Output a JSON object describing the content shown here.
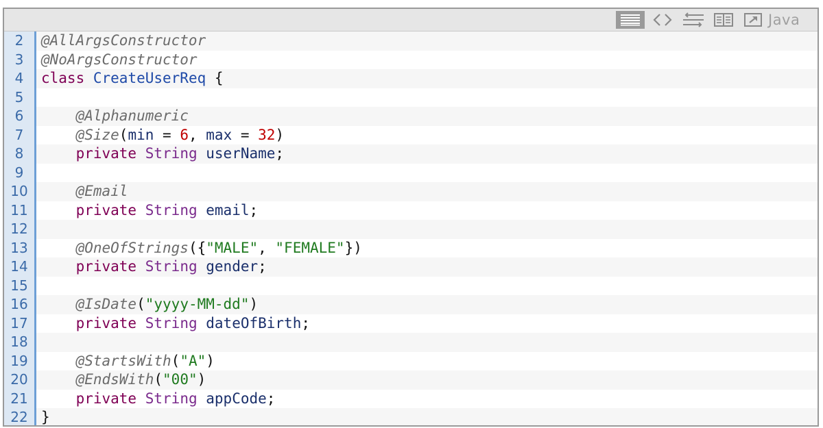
{
  "toolbar": {
    "icons": [
      {
        "name": "view-source-icon"
      },
      {
        "name": "code-brackets-icon"
      },
      {
        "name": "wrap-lines-icon"
      },
      {
        "name": "copy-icon"
      },
      {
        "name": "popout-icon"
      }
    ],
    "language": "Java"
  },
  "colors": {
    "annotation": "#6b6b6b",
    "keyword": "#7f0055",
    "type": "#7a2a8c",
    "class_name": "#1f4aa8",
    "identifier": "#1a2f6b",
    "string": "#1f7a1f",
    "number": "#c00000",
    "gutter_bg": "#dde8f4",
    "gutter_border": "#6d9fd6",
    "gutter_text": "#3a6aa8"
  },
  "code": {
    "lines": [
      {
        "n": "2",
        "t": [
          [
            "ann",
            "@AllArgsConstructor"
          ]
        ]
      },
      {
        "n": "3",
        "t": [
          [
            "ann",
            "@NoArgsConstructor"
          ]
        ]
      },
      {
        "n": "4",
        "t": [
          [
            "kw",
            "class"
          ],
          [
            "pun",
            " "
          ],
          [
            "cls",
            "CreateUserReq"
          ],
          [
            "pun",
            " {"
          ]
        ]
      },
      {
        "n": "5",
        "t": []
      },
      {
        "n": "6",
        "t": [
          [
            "pun",
            "    "
          ],
          [
            "ann",
            "@Alphanumeric"
          ]
        ]
      },
      {
        "n": "7",
        "t": [
          [
            "pun",
            "    "
          ],
          [
            "ann",
            "@Size"
          ],
          [
            "pun",
            "("
          ],
          [
            "id",
            "min"
          ],
          [
            "pun",
            " = "
          ],
          [
            "num",
            "6"
          ],
          [
            "pun",
            ", "
          ],
          [
            "id",
            "max"
          ],
          [
            "pun",
            " = "
          ],
          [
            "num",
            "32"
          ],
          [
            "pun",
            ")"
          ]
        ]
      },
      {
        "n": "8",
        "t": [
          [
            "pun",
            "    "
          ],
          [
            "kw",
            "private"
          ],
          [
            "pun",
            " "
          ],
          [
            "type",
            "String"
          ],
          [
            "pun",
            " "
          ],
          [
            "id",
            "userName"
          ],
          [
            "pun",
            ";"
          ]
        ]
      },
      {
        "n": "9",
        "t": []
      },
      {
        "n": "10",
        "t": [
          [
            "pun",
            "    "
          ],
          [
            "ann",
            "@Email"
          ]
        ]
      },
      {
        "n": "11",
        "t": [
          [
            "pun",
            "    "
          ],
          [
            "kw",
            "private"
          ],
          [
            "pun",
            " "
          ],
          [
            "type",
            "String"
          ],
          [
            "pun",
            " "
          ],
          [
            "id",
            "email"
          ],
          [
            "pun",
            ";"
          ]
        ]
      },
      {
        "n": "12",
        "t": []
      },
      {
        "n": "13",
        "t": [
          [
            "pun",
            "    "
          ],
          [
            "ann",
            "@OneOfStrings"
          ],
          [
            "pun",
            "({"
          ],
          [
            "str",
            "\"MALE\""
          ],
          [
            "pun",
            ", "
          ],
          [
            "str",
            "\"FEMALE\""
          ],
          [
            "pun",
            "})"
          ]
        ]
      },
      {
        "n": "14",
        "t": [
          [
            "pun",
            "    "
          ],
          [
            "kw",
            "private"
          ],
          [
            "pun",
            " "
          ],
          [
            "type",
            "String"
          ],
          [
            "pun",
            " "
          ],
          [
            "id",
            "gender"
          ],
          [
            "pun",
            ";"
          ]
        ]
      },
      {
        "n": "15",
        "t": []
      },
      {
        "n": "16",
        "t": [
          [
            "pun",
            "    "
          ],
          [
            "ann",
            "@IsDate"
          ],
          [
            "pun",
            "("
          ],
          [
            "str",
            "\"yyyy-MM-dd\""
          ],
          [
            "pun",
            ")"
          ]
        ]
      },
      {
        "n": "17",
        "t": [
          [
            "pun",
            "    "
          ],
          [
            "kw",
            "private"
          ],
          [
            "pun",
            " "
          ],
          [
            "type",
            "String"
          ],
          [
            "pun",
            " "
          ],
          [
            "id",
            "dateOfBirth"
          ],
          [
            "pun",
            ";"
          ]
        ]
      },
      {
        "n": "18",
        "t": []
      },
      {
        "n": "19",
        "t": [
          [
            "pun",
            "    "
          ],
          [
            "ann",
            "@StartsWith"
          ],
          [
            "pun",
            "("
          ],
          [
            "str",
            "\"A\""
          ],
          [
            "pun",
            ")"
          ]
        ]
      },
      {
        "n": "20",
        "t": [
          [
            "pun",
            "    "
          ],
          [
            "ann",
            "@EndsWith"
          ],
          [
            "pun",
            "("
          ],
          [
            "str",
            "\"00\""
          ],
          [
            "pun",
            ")"
          ]
        ]
      },
      {
        "n": "21",
        "t": [
          [
            "pun",
            "    "
          ],
          [
            "kw",
            "private"
          ],
          [
            "pun",
            " "
          ],
          [
            "type",
            "String"
          ],
          [
            "pun",
            " "
          ],
          [
            "id",
            "appCode"
          ],
          [
            "pun",
            ";"
          ]
        ]
      },
      {
        "n": "22",
        "t": [
          [
            "pun",
            "}"
          ]
        ]
      }
    ]
  }
}
